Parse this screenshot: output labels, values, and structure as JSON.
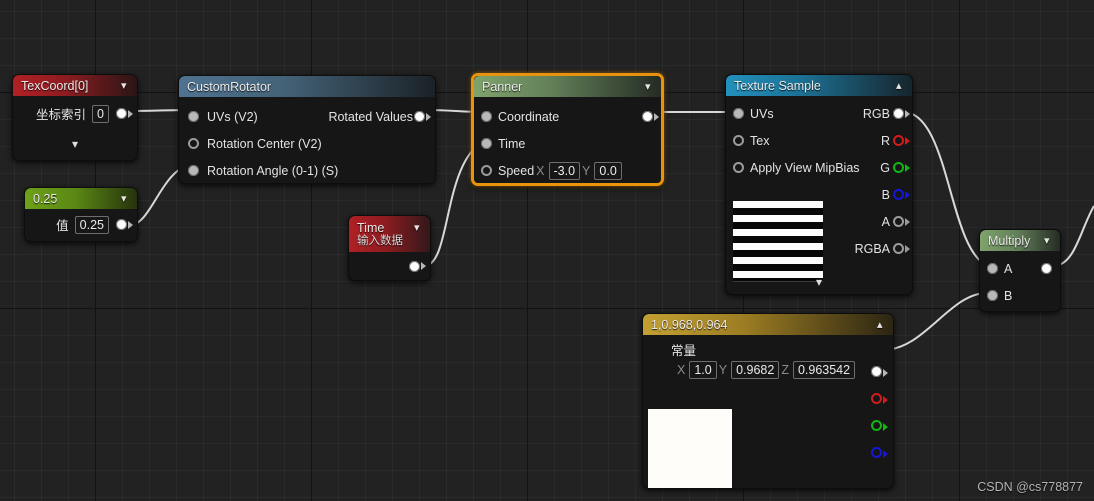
{
  "watermark": "CSDN @cs778877",
  "nodes": {
    "texcoord": {
      "title": "TexCoord[0]",
      "param_label": "坐标索引",
      "param_value": "0"
    },
    "constant_025": {
      "title": "0.25",
      "param_label": "值",
      "param_value": "0.25"
    },
    "custom_rotator": {
      "title": "CustomRotator",
      "inputs": [
        "UVs (V2)",
        "Rotation Center (V2)",
        "Rotation Angle (0-1) (S)"
      ],
      "output": "Rotated Values"
    },
    "time": {
      "title": "Time",
      "subtitle": "输入数据"
    },
    "panner": {
      "title": "Panner",
      "inputs": [
        "Coordinate",
        "Time",
        "Speed"
      ],
      "speed_x_label": "X",
      "speed_x": "-3.0",
      "speed_y_label": "Y",
      "speed_y": "0.0"
    },
    "texture_sample": {
      "title": "Texture Sample",
      "inputs": [
        "UVs",
        "Tex",
        "Apply View MipBias"
      ],
      "outputs": [
        "RGB",
        "R",
        "G",
        "B",
        "A",
        "RGBA"
      ]
    },
    "constant3": {
      "title": "1,0.968,0.964",
      "param_label": "常量",
      "x_label": "X",
      "x": "1.0",
      "y_label": "Y",
      "y": "0.9682",
      "z_label": "Z",
      "z": "0.963542"
    },
    "multiply": {
      "title": "Multiply",
      "inputs": [
        "A",
        "B"
      ]
    }
  },
  "colors": {
    "selection": "#e8920e",
    "header_texcoord": "#b02024",
    "header_constant": "#5f9113",
    "header_rotator": "#4f7290",
    "header_time": "#b02024",
    "header_panner": "#6d8f5e",
    "header_texture": "#1f7fa8",
    "header_gold": "#b8952a",
    "header_multiply": "#6d8f5e",
    "pin_red": "#d21b1b",
    "pin_green": "#12b512",
    "pin_blue": "#1616d8",
    "wire": "#d8d8d8"
  }
}
